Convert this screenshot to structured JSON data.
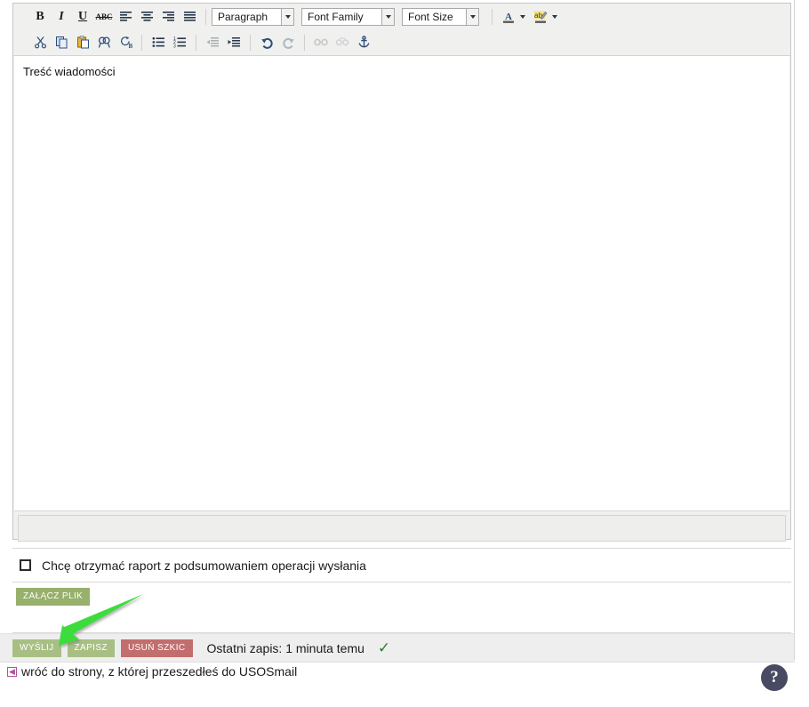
{
  "editor": {
    "toolbar_row1": [
      {
        "name": "bold-icon",
        "label": "B"
      },
      {
        "name": "italic-icon",
        "label": "I"
      },
      {
        "name": "underline-icon",
        "label": "U"
      },
      {
        "name": "strikethrough-icon",
        "label": "ABC"
      },
      {
        "name": "align-left-icon",
        "label": "align left"
      },
      {
        "name": "align-center-icon",
        "label": "align center"
      },
      {
        "name": "align-right-icon",
        "label": "align right"
      },
      {
        "name": "align-justify-icon",
        "label": "justify"
      }
    ],
    "toolbar_row2": [
      {
        "name": "cut-icon",
        "label": "cut"
      },
      {
        "name": "copy-icon",
        "label": "copy"
      },
      {
        "name": "paste-icon",
        "label": "paste"
      },
      {
        "name": "find-icon",
        "label": "find"
      },
      {
        "name": "find-replace-icon",
        "label": "find and replace"
      },
      {
        "name": "bullet-list-icon",
        "label": "unordered list"
      },
      {
        "name": "numbered-list-icon",
        "label": "ordered list"
      },
      {
        "name": "outdent-icon",
        "label": "outdent"
      },
      {
        "name": "indent-icon",
        "label": "indent"
      },
      {
        "name": "undo-icon",
        "label": "undo"
      },
      {
        "name": "redo-icon",
        "label": "redo"
      },
      {
        "name": "link-icon",
        "label": "insert link"
      },
      {
        "name": "unlink-icon",
        "label": "remove link"
      },
      {
        "name": "anchor-icon",
        "label": "anchor"
      }
    ],
    "dropdowns": {
      "paragraph": "Paragraph",
      "font_family": "Font Family",
      "font_size": "Font Size"
    },
    "color_pickers": {
      "text_color": "A",
      "background_color": "ab"
    },
    "body_text": "Treść wiadomości"
  },
  "report_option": {
    "checkbox_checked": false,
    "label": "Chcę otrzymać raport z podsumowaniem operacji wysłania"
  },
  "attachment": {
    "button_label": "ZAŁĄCZ PLIK"
  },
  "actions": {
    "send_label": "WYŚLIJ",
    "save_label": "ZAPISZ",
    "delete_draft_label": "USUŃ SZKIC",
    "save_status": "Ostatni zapis: 1 minuta temu",
    "saved_tick": "✓"
  },
  "footer": {
    "back_link": "wróć do strony, z której przeszedłeś do USOSmail",
    "back_icon_glyph": "◀",
    "help_label": "?"
  },
  "colors": {
    "send_button": "#a8bf84",
    "save_button": "#a8bf84",
    "delete_button": "#c26e6e",
    "attach_button": "#97b06c",
    "annotation_arrow": "#3ddc3d",
    "help_bubble": "#484a62",
    "tick_green": "#2f7d32",
    "back_icon": "#b0539b"
  }
}
